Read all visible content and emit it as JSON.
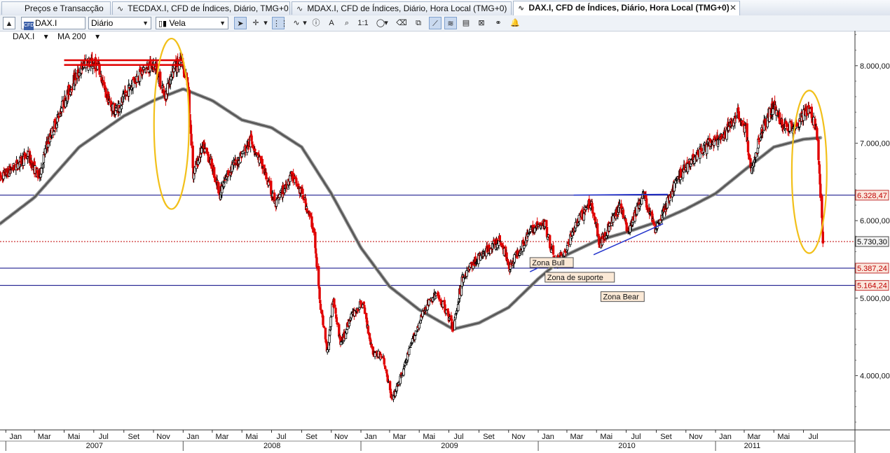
{
  "tabs": [
    {
      "label": "Preços e Transacção",
      "active": false
    },
    {
      "label": "TECDAX.I, CFD de Índices, Diário, TMG+0",
      "active": false
    },
    {
      "label": "MDAX.I, CFD de Índices, Diário, Hora Local (TMG+0)",
      "active": false
    },
    {
      "label": "DAX.I, CFD de Índices, Diário, Hora Local (TMG+0)",
      "active": true
    }
  ],
  "toolbar": {
    "symbol": "DAX.I",
    "period": "Diário",
    "chart_style": "Vela",
    "zoom_label": "1:1"
  },
  "subbar": {
    "symbol": "DAX.I",
    "indicator": "MA 200"
  },
  "colors": {
    "bear": "#e00000",
    "bull": "#000000",
    "ma": "#555555",
    "hline": "#000080",
    "support_dotted": "#c00000",
    "circle": "#f2c01a",
    "trend": "#2233cc"
  },
  "chart_data": {
    "type": "candlestick",
    "indicator": "MA 200",
    "ylim": [
      3300,
      8450
    ],
    "y_ticks": [
      {
        "value": 8000,
        "label": "8.000,00"
      },
      {
        "value": 7000,
        "label": "7.000,00"
      },
      {
        "value": 6000,
        "label": "6.000,00"
      },
      {
        "value": 5000,
        "label": "5.000,00"
      },
      {
        "value": 4000,
        "label": "4.000,00"
      }
    ],
    "price_labels": [
      {
        "value": 6328.47,
        "label": "6.328,47",
        "style": "red"
      },
      {
        "value": 5730.3,
        "label": "5.730,30",
        "style": "black"
      },
      {
        "value": 5387.24,
        "label": "5.387,24",
        "style": "red"
      },
      {
        "value": 5164.24,
        "label": "5.164,24",
        "style": "red"
      }
    ],
    "x_start": "2006-12-20",
    "x_end": "2011-10-15",
    "months": [
      {
        "date": "2007-01-01",
        "label": "Jan"
      },
      {
        "date": "2007-03-01",
        "label": "Mar"
      },
      {
        "date": "2007-05-01",
        "label": "Mai"
      },
      {
        "date": "2007-07-01",
        "label": "Jul"
      },
      {
        "date": "2007-09-01",
        "label": "Set"
      },
      {
        "date": "2007-11-01",
        "label": "Nov"
      },
      {
        "date": "2008-01-01",
        "label": "Jan"
      },
      {
        "date": "2008-03-01",
        "label": "Mar"
      },
      {
        "date": "2008-05-01",
        "label": "Mai"
      },
      {
        "date": "2008-07-01",
        "label": "Jul"
      },
      {
        "date": "2008-09-01",
        "label": "Set"
      },
      {
        "date": "2008-11-01",
        "label": "Nov"
      },
      {
        "date": "2009-01-01",
        "label": "Jan"
      },
      {
        "date": "2009-03-01",
        "label": "Mar"
      },
      {
        "date": "2009-05-01",
        "label": "Mai"
      },
      {
        "date": "2009-07-01",
        "label": "Jul"
      },
      {
        "date": "2009-09-01",
        "label": "Set"
      },
      {
        "date": "2009-11-01",
        "label": "Nov"
      },
      {
        "date": "2010-01-01",
        "label": "Jan"
      },
      {
        "date": "2010-03-01",
        "label": "Mar"
      },
      {
        "date": "2010-05-01",
        "label": "Mai"
      },
      {
        "date": "2010-07-01",
        "label": "Jul"
      },
      {
        "date": "2010-09-01",
        "label": "Set"
      },
      {
        "date": "2010-11-01",
        "label": "Nov"
      },
      {
        "date": "2011-01-01",
        "label": "Jan"
      },
      {
        "date": "2011-03-01",
        "label": "Mar"
      },
      {
        "date": "2011-05-01",
        "label": "Mai"
      },
      {
        "date": "2011-07-01",
        "label": "Jul"
      }
    ],
    "years": [
      {
        "date": "2007-01-01",
        "label": "2007"
      },
      {
        "date": "2008-01-01",
        "label": "2008"
      },
      {
        "date": "2009-01-01",
        "label": "2009"
      },
      {
        "date": "2010-01-01",
        "label": "2010"
      },
      {
        "date": "2011-01-01",
        "label": "2011"
      }
    ],
    "price_path": [
      [
        "2006-12-20",
        6550
      ],
      [
        "2007-01-20",
        6700
      ],
      [
        "2007-02-15",
        6850
      ],
      [
        "2007-03-10",
        6550
      ],
      [
        "2007-03-25",
        6950
      ],
      [
        "2007-04-25",
        7450
      ],
      [
        "2007-05-20",
        7800
      ],
      [
        "2007-06-15",
        8050
      ],
      [
        "2007-07-10",
        8000
      ],
      [
        "2007-07-25",
        7650
      ],
      [
        "2007-08-12",
        7400
      ],
      [
        "2007-08-30",
        7550
      ],
      [
        "2007-09-20",
        7800
      ],
      [
        "2007-10-15",
        7950
      ],
      [
        "2007-11-05",
        8000
      ],
      [
        "2007-11-25",
        7600
      ],
      [
        "2007-12-10",
        7950
      ],
      [
        "2007-12-28",
        8050
      ],
      [
        "2008-01-10",
        7800
      ],
      [
        "2008-01-22",
        6600
      ],
      [
        "2008-02-10",
        6950
      ],
      [
        "2008-02-25",
        6800
      ],
      [
        "2008-03-17",
        6350
      ],
      [
        "2008-04-05",
        6650
      ],
      [
        "2008-04-25",
        6800
      ],
      [
        "2008-05-20",
        7050
      ],
      [
        "2008-06-15",
        6650
      ],
      [
        "2008-07-10",
        6200
      ],
      [
        "2008-08-10",
        6600
      ],
      [
        "2008-09-05",
        6300
      ],
      [
        "2008-09-25",
        5900
      ],
      [
        "2008-10-10",
        4900
      ],
      [
        "2008-10-24",
        4300
      ],
      [
        "2008-11-05",
        5000
      ],
      [
        "2008-11-21",
        4400
      ],
      [
        "2008-12-10",
        4750
      ],
      [
        "2009-01-05",
        4950
      ],
      [
        "2009-01-25",
        4300
      ],
      [
        "2009-02-15",
        4250
      ],
      [
        "2009-03-06",
        3680
      ],
      [
        "2009-03-25",
        4000
      ],
      [
        "2009-04-20",
        4500
      ],
      [
        "2009-05-15",
        4900
      ],
      [
        "2009-06-05",
        5050
      ],
      [
        "2009-06-25",
        4850
      ],
      [
        "2009-07-10",
        4600
      ],
      [
        "2009-07-28",
        5250
      ],
      [
        "2009-08-20",
        5450
      ],
      [
        "2009-09-15",
        5600
      ],
      [
        "2009-10-15",
        5750
      ],
      [
        "2009-11-03",
        5400
      ],
      [
        "2009-11-25",
        5650
      ],
      [
        "2009-12-20",
        5900
      ],
      [
        "2010-01-15",
        5950
      ],
      [
        "2010-02-05",
        5450
      ],
      [
        "2010-02-25",
        5600
      ],
      [
        "2010-03-20",
        5950
      ],
      [
        "2010-04-20",
        6250
      ],
      [
        "2010-05-07",
        5700
      ],
      [
        "2010-05-25",
        5900
      ],
      [
        "2010-06-20",
        6200
      ],
      [
        "2010-07-05",
        5850
      ],
      [
        "2010-08-05",
        6350
      ],
      [
        "2010-08-30",
        5900
      ],
      [
        "2010-09-25",
        6250
      ],
      [
        "2010-10-20",
        6600
      ],
      [
        "2010-11-15",
        6800
      ],
      [
        "2010-12-20",
        7000
      ],
      [
        "2011-01-15",
        7050
      ],
      [
        "2011-02-15",
        7400
      ],
      [
        "2011-03-05",
        7150
      ],
      [
        "2011-03-16",
        6600
      ],
      [
        "2011-04-05",
        7150
      ],
      [
        "2011-05-01",
        7500
      ],
      [
        "2011-05-20",
        7200
      ],
      [
        "2011-06-20",
        7250
      ],
      [
        "2011-07-10",
        7450
      ],
      [
        "2011-07-28",
        7200
      ],
      [
        "2011-08-05",
        6350
      ],
      [
        "2011-08-10",
        5730
      ]
    ],
    "ma200_path": [
      [
        "2006-12-20",
        5960
      ],
      [
        "2007-03-01",
        6300
      ],
      [
        "2007-06-01",
        6950
      ],
      [
        "2007-09-01",
        7350
      ],
      [
        "2007-11-01",
        7550
      ],
      [
        "2008-01-01",
        7700
      ],
      [
        "2008-03-01",
        7550
      ],
      [
        "2008-05-01",
        7300
      ],
      [
        "2008-07-01",
        7200
      ],
      [
        "2008-09-01",
        6950
      ],
      [
        "2008-11-01",
        6350
      ],
      [
        "2009-01-01",
        5650
      ],
      [
        "2009-03-01",
        5150
      ],
      [
        "2009-05-01",
        4850
      ],
      [
        "2009-07-10",
        4600
      ],
      [
        "2009-09-01",
        4680
      ],
      [
        "2009-11-01",
        4880
      ],
      [
        "2010-01-01",
        5250
      ],
      [
        "2010-03-01",
        5560
      ],
      [
        "2010-05-01",
        5740
      ],
      [
        "2010-07-01",
        5850
      ],
      [
        "2010-09-01",
        5980
      ],
      [
        "2010-11-01",
        6150
      ],
      [
        "2011-01-01",
        6350
      ],
      [
        "2011-03-01",
        6650
      ],
      [
        "2011-05-01",
        6950
      ],
      [
        "2011-07-01",
        7050
      ],
      [
        "2011-08-05",
        7070
      ]
    ],
    "horizontal_lines": [
      {
        "value": 6328.47,
        "style": "solid"
      },
      {
        "value": 5730.3,
        "style": "dotted"
      },
      {
        "value": 5387.24,
        "style": "solid"
      },
      {
        "value": 5164.24,
        "style": "solid"
      }
    ],
    "resistance": {
      "start": "2007-05-01",
      "end": "2007-12-31",
      "values": [
        8070,
        8010
      ]
    },
    "trend_lines": [
      {
        "start": "2010-03-15",
        "start_value": 6330,
        "end": "2010-09-25",
        "end_value": 6340
      },
      {
        "start": "2010-04-25",
        "start_value": 5560,
        "end": "2010-09-15",
        "end_value": 5960
      },
      {
        "start": "2009-12-15",
        "start_value": 5340,
        "end": "2010-01-20",
        "end_value": 5450
      }
    ],
    "circles": [
      {
        "center": "2007-12-08",
        "center_value": 7250,
        "span_days": 72,
        "span_value": 2200
      },
      {
        "center": "2011-07-13",
        "center_value": 6630,
        "span_days": 72,
        "span_value": 2100
      }
    ],
    "annotations": [
      {
        "text": "Zona Bull",
        "date": "2009-12-15",
        "value": 5460
      },
      {
        "text": "Zona de suporte",
        "date": "2010-01-15",
        "value": 5270
      },
      {
        "text": "Zona Bear",
        "date": "2010-05-10",
        "value": 5020
      }
    ]
  }
}
